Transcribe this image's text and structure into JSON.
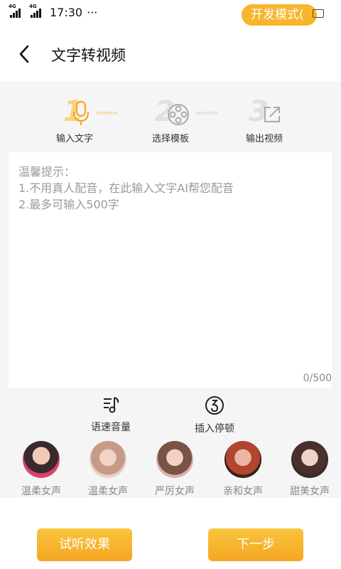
{
  "status_bar": {
    "network1": "4G",
    "network2": "4G",
    "time": "17:30",
    "dots": "···",
    "dev_mode": "开发模式("
  },
  "header": {
    "title": "文字转视频",
    "back_icon": "chevron-left-icon"
  },
  "steps": [
    {
      "number": "1",
      "label": "输入文字",
      "icon": "microphone-icon",
      "active": true
    },
    {
      "number": "2",
      "label": "选择模板",
      "icon": "film-reel-icon",
      "active": false
    },
    {
      "number": "3",
      "label": "输出视频",
      "icon": "export-icon",
      "active": false
    }
  ],
  "step_arrows": "›››››››››",
  "textarea": {
    "hint_title": "温馨提示：",
    "hint_line1": "1.不用真人配音，在此输入文字AI帮您配音",
    "hint_line2": "2.最多可输入500字",
    "counter": "0/500"
  },
  "tools": [
    {
      "label": "语速音量",
      "icon": "speed-volume-icon"
    },
    {
      "label": "插入停顿",
      "icon": "pause-insert-icon"
    }
  ],
  "voices": [
    {
      "label": "温柔女声"
    },
    {
      "label": "温柔女声"
    },
    {
      "label": "严厉女声"
    },
    {
      "label": "亲和女声"
    },
    {
      "label": "甜美女声"
    }
  ],
  "buttons": {
    "preview": "试听效果",
    "next": "下一步"
  },
  "colors": {
    "accent": "#f5a623",
    "step_active": "#f9c43d"
  }
}
